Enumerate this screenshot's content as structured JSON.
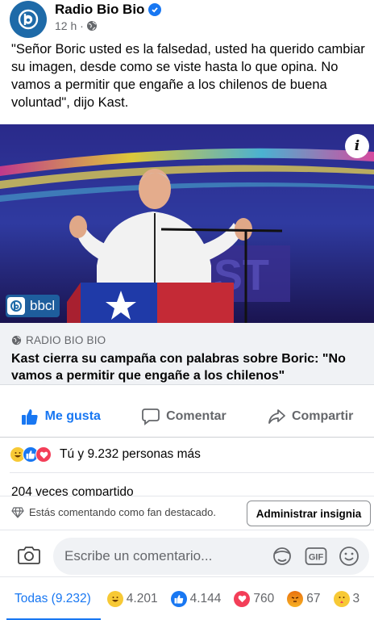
{
  "post": {
    "page_name": "Radio Bio Bio",
    "time": "12 h ·",
    "text": "\"Señor Boric usted es la falsedad, usted ha querido cambiar su imagen, desde como se viste hasta lo que opina. No vamos a permitir que engañe a los chilenos de buena voluntad\", dijo Kast.",
    "image_badge": "bbcl"
  },
  "link": {
    "source": "RADIO BIO BIO",
    "title": "Kast cierra su campaña con palabras sobre Boric: \"No vamos a permitir que engañe a los chilenos\""
  },
  "actions": {
    "like": "Me gusta",
    "comment": "Comentar",
    "share": "Compartir"
  },
  "reactions": {
    "summary": "Tú y 9.232 personas más",
    "shares": "204 veces compartido"
  },
  "fan": {
    "text": "Estás comentando como fan destacado.",
    "button": "Administrar insignia"
  },
  "composer": {
    "placeholder": "Escribe un comentario...",
    "gif": "GIF"
  },
  "tabs": {
    "all": "Todas (9.232)",
    "haha": "4.201",
    "like": "4.144",
    "love": "760",
    "angry": "67",
    "care": "3"
  },
  "colors": {
    "accent": "#1877f2",
    "brand": "#1e6aa8",
    "muted": "#65676b"
  }
}
